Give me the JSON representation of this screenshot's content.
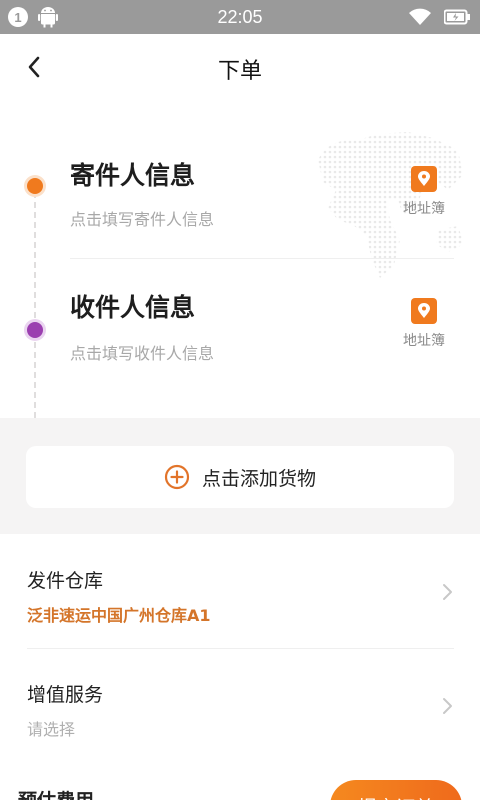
{
  "status_bar": {
    "notification_count": "1",
    "time": "22:05"
  },
  "nav": {
    "title": "下单"
  },
  "sender": {
    "title": "寄件人信息",
    "subtitle": "点击填写寄件人信息",
    "address_book": "地址簿"
  },
  "receiver": {
    "title": "收件人信息",
    "subtitle": "点击填写收件人信息",
    "address_book": "地址簿"
  },
  "goods": {
    "add_label": "点击添加货物"
  },
  "warehouse": {
    "title": "发件仓库",
    "value": "泛非速运中国广州仓库A1"
  },
  "value_added": {
    "title": "增值服务",
    "value": "请选择"
  },
  "footer": {
    "estimate_label": "预估费用",
    "submit_label": "提交订单"
  },
  "colors": {
    "accent": "#f07a1e",
    "receiver_dot": "#9b3fb0",
    "warehouse_text": "#d4752a",
    "status_bar": "#9a9a9a"
  }
}
